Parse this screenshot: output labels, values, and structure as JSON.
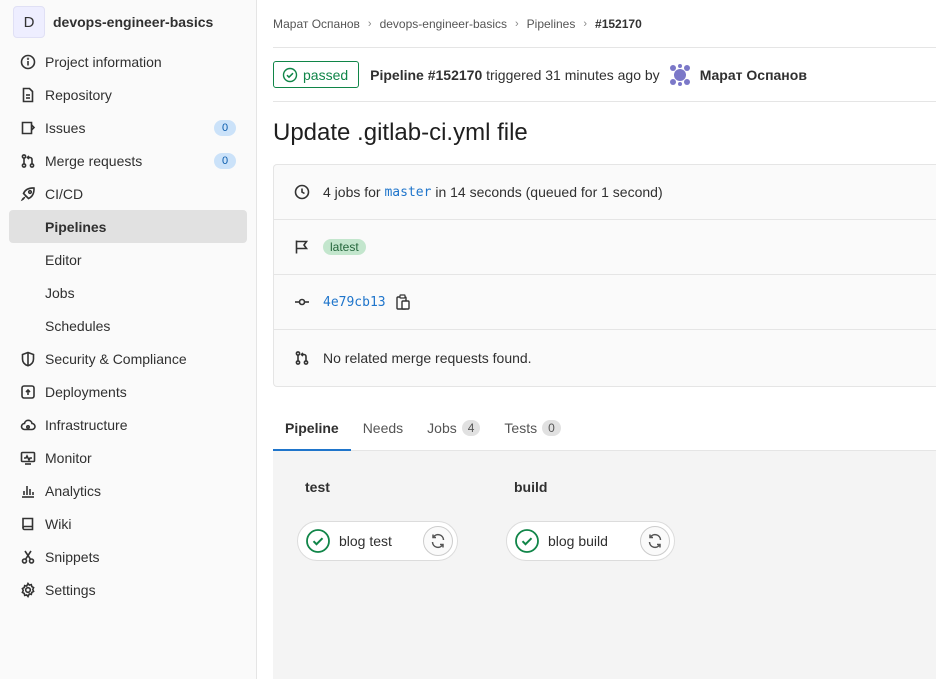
{
  "project": {
    "avatar_letter": "D",
    "name": "devops-engineer-basics"
  },
  "sidebar": {
    "items": [
      {
        "label": "Project information",
        "icon": "info-icon"
      },
      {
        "label": "Repository",
        "icon": "document-icon"
      },
      {
        "label": "Issues",
        "icon": "issues-icon",
        "count": "0"
      },
      {
        "label": "Merge requests",
        "icon": "merge-request-icon",
        "count": "0"
      },
      {
        "label": "CI/CD",
        "icon": "rocket-icon"
      },
      {
        "label": "Pipelines",
        "sub": true,
        "active": true
      },
      {
        "label": "Editor",
        "sub": true
      },
      {
        "label": "Jobs",
        "sub": true
      },
      {
        "label": "Schedules",
        "sub": true
      },
      {
        "label": "Security & Compliance",
        "icon": "shield-icon"
      },
      {
        "label": "Deployments",
        "icon": "deployments-icon"
      },
      {
        "label": "Infrastructure",
        "icon": "cloud-icon"
      },
      {
        "label": "Monitor",
        "icon": "monitor-icon"
      },
      {
        "label": "Analytics",
        "icon": "chart-icon"
      },
      {
        "label": "Wiki",
        "icon": "book-icon"
      },
      {
        "label": "Snippets",
        "icon": "scissors-icon"
      },
      {
        "label": "Settings",
        "icon": "gear-icon"
      }
    ]
  },
  "breadcrumb": {
    "user": "Марат Оспанов",
    "project": "devops-engineer-basics",
    "section": "Pipelines",
    "current": "#152170"
  },
  "pipeline": {
    "status": "passed",
    "name": "Pipeline #152170",
    "triggered_text": "triggered 31 minutes ago by",
    "user": "Марат Оспанов",
    "title": "Update .gitlab-ci.yml file",
    "jobs_prefix": "4 jobs for",
    "branch": "master",
    "jobs_suffix": "in 14 seconds (queued for 1 second)",
    "tag": "latest",
    "commit": "4e79cb13",
    "mr_text": "No related merge requests found."
  },
  "tabs": [
    {
      "label": "Pipeline",
      "active": true
    },
    {
      "label": "Needs"
    },
    {
      "label": "Jobs",
      "count": "4"
    },
    {
      "label": "Tests",
      "count": "0"
    }
  ],
  "stages": [
    {
      "name": "test",
      "job": "blog test"
    },
    {
      "name": "build",
      "job": "blog build"
    }
  ],
  "colors": {
    "success": "#108548",
    "link": "#1f75cb",
    "badge_bg": "#cbe2f9"
  }
}
